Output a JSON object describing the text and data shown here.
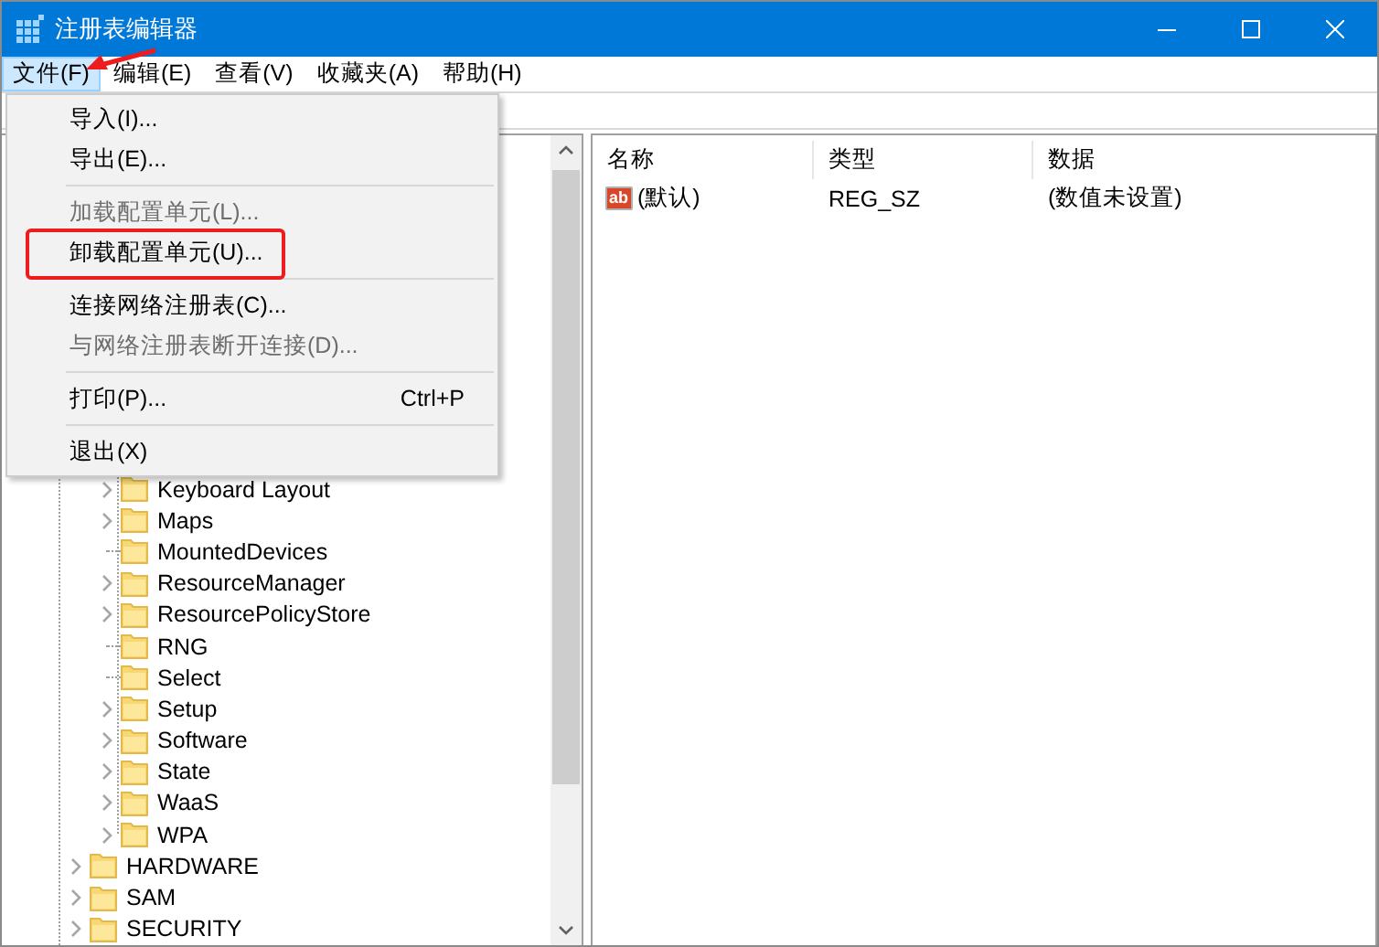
{
  "window": {
    "title": "注册表编辑器"
  },
  "menu_bar": [
    {
      "label": "文件(F)",
      "selected": true
    },
    {
      "label": "编辑(E)",
      "selected": false
    },
    {
      "label": "查看(V)",
      "selected": false
    },
    {
      "label": "收藏夹(A)",
      "selected": false
    },
    {
      "label": "帮助(H)",
      "selected": false
    }
  ],
  "file_menu": [
    {
      "kind": "item",
      "label": "导入(I)...",
      "disabled": false,
      "highlighted": false
    },
    {
      "kind": "item",
      "label": "导出(E)...",
      "disabled": false,
      "highlighted": false
    },
    {
      "kind": "separator"
    },
    {
      "kind": "item",
      "label": "加载配置单元(L)...",
      "disabled": true,
      "highlighted": false
    },
    {
      "kind": "item",
      "label": "卸载配置单元(U)...",
      "disabled": false,
      "highlighted": true
    },
    {
      "kind": "separator"
    },
    {
      "kind": "item",
      "label": "连接网络注册表(C)...",
      "disabled": false,
      "highlighted": false
    },
    {
      "kind": "item",
      "label": "与网络注册表断开连接(D)...",
      "disabled": true,
      "highlighted": false
    },
    {
      "kind": "separator"
    },
    {
      "kind": "item",
      "label": "打印(P)...",
      "shortcut": "Ctrl+P",
      "disabled": false,
      "highlighted": false
    },
    {
      "kind": "separator"
    },
    {
      "kind": "item",
      "label": "退出(X)",
      "disabled": false,
      "highlighted": false
    }
  ],
  "tree": [
    {
      "children": [
        {
          "label": "Keyboard Layout",
          "expandable": true
        },
        {
          "label": "Maps",
          "expandable": true
        },
        {
          "label": "MountedDevices",
          "expandable": false
        },
        {
          "label": "ResourceManager",
          "expandable": true
        },
        {
          "label": "ResourcePolicyStore",
          "expandable": true
        },
        {
          "label": "RNG",
          "expandable": false
        },
        {
          "label": "Select",
          "expandable": false
        },
        {
          "label": "Setup",
          "expandable": true
        },
        {
          "label": "Software",
          "expandable": true
        },
        {
          "label": "State",
          "expandable": true
        },
        {
          "label": "WaaS",
          "expandable": true
        },
        {
          "label": "WPA",
          "expandable": true
        }
      ]
    },
    {
      "label": "HARDWARE",
      "expandable": true
    },
    {
      "label": "SAM",
      "expandable": true
    },
    {
      "label": "SECURITY",
      "expandable": true
    }
  ],
  "list": {
    "columns": [
      "名称",
      "类型",
      "数据"
    ],
    "rows": [
      {
        "icon_text": "ab",
        "name": "(默认)",
        "type": "REG_SZ",
        "data": "(数值未设置)"
      }
    ]
  }
}
